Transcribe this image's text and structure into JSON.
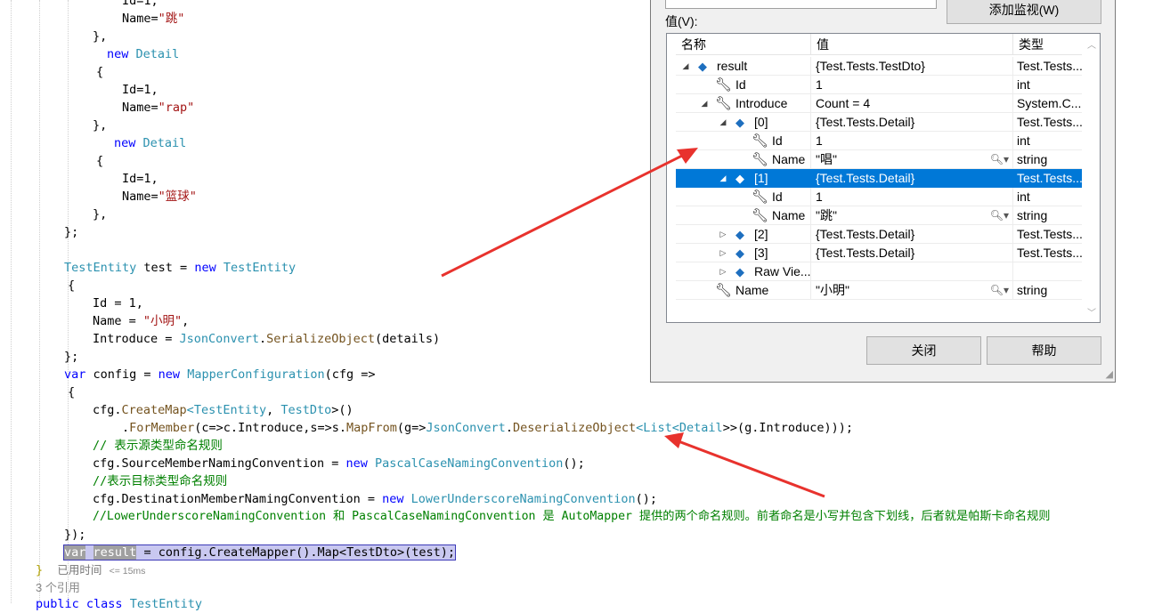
{
  "code": {
    "l1": "Id=1,",
    "l2_pre": "Name=",
    "l2_str": "\"跳\"",
    "l3": "},",
    "l4_kw": "new",
    "l4_ty": "Detail",
    "brace_open": "{",
    "l6": "Id=1,",
    "l7_pre": "Name=",
    "l7_str": "\"rap\"",
    "l8": "},",
    "l9_kw": "new",
    "l9_ty": "Detail",
    "l11": "Id=1,",
    "l12_pre": "Name=",
    "l12_str": "\"篮球\"",
    "l13": "},",
    "l14": "};",
    "l15_ty": "TestEntity",
    "l15_mid": " test = ",
    "l15_kw": "new",
    "l15_ty2": "TestEntity",
    "l17": "Id = 1,",
    "l18_pre": "Name = ",
    "l18_str": "\"小明\"",
    "l18_post": ",",
    "l19_pre": "Introduce = ",
    "l19_ty": "JsonConvert",
    "l19_dot": ".",
    "l19_mt": "SerializeObject",
    "l19_post": "(details)",
    "l20": "};",
    "l21_kw": "var",
    "l21_mid": " config = ",
    "l21_kw2": "new",
    "l21_ty": "MapperConfiguration",
    "l21_post": "(cfg =>",
    "l23_pre": "cfg.",
    "l23_mt": "CreateMap",
    "l23_lt": "<",
    "l23_ty1": "TestEntity",
    "l23_comma": ", ",
    "l23_ty2": "TestDto",
    "l23_post": ">()",
    "l24_pre": ".",
    "l24_mt": "ForMember",
    "l24_mid": "(c=>c.Introduce,s=>s.",
    "l24_mt2": "MapFrom",
    "l24_mid2": "(g=>",
    "l24_ty1": "JsonConvert",
    "l24_dot": ".",
    "l24_mt3": "DeserializeObject",
    "l24_lt": "<",
    "l24_ty2": "List",
    "l24_lt2": "<",
    "l24_ty3": "Detail",
    "l24_post": ">>(g.Introduce)));",
    "l25": "// 表示源类型命名规则",
    "l26_pre": "cfg.SourceMemberNamingConvention = ",
    "l26_kw": "new",
    "l26_ty": "PascalCaseNamingConvention",
    "l26_post": "();",
    "l27": "//表示目标类型命名规则",
    "l28_pre": "cfg.DestinationMemberNamingConvention = ",
    "l28_kw": "new",
    "l28_ty": "LowerUnderscoreNamingConvention",
    "l28_post": "();",
    "l29": "//LowerUnderscoreNamingConvention 和 PascalCaseNamingConvention 是 AutoMapper 提供的两个命名规则。前者命名是小写并包含下划线，后者就是帕斯卡命名规则",
    "l30": "});",
    "l31_kw": "var",
    "l31_var": "result",
    "l31_mid": " = config.",
    "l31_mt": "CreateMapper",
    "l31_mid2": "().",
    "l31_mt2": "Map",
    "l31_lt": "<",
    "l31_ty": "TestDto",
    "l31_post": ">(test);",
    "l32_brace": "}",
    "l32_hint": "已用时间",
    "l32_hint2": "<= 15ms",
    "l33_refs": "3 个引用",
    "l34_kw": "public",
    "l34_kw2": "class",
    "l34_ty": "TestEntity"
  },
  "quickwatch": {
    "add_watch": "添加监视(W)",
    "value_label": "值(V):",
    "columns": {
      "name": "名称",
      "value": "值",
      "type": "类型"
    },
    "rows": [
      {
        "name": "result",
        "value": "{Test.Tests.TestDto}",
        "type": "Test.Tests..."
      },
      {
        "name": "Id",
        "value": "1",
        "type": "int"
      },
      {
        "name": "Introduce",
        "value": "Count = 4",
        "type": "System.C..."
      },
      {
        "name": "[0]",
        "value": "{Test.Tests.Detail}",
        "type": "Test.Tests..."
      },
      {
        "name": "Id",
        "value": "1",
        "type": "int"
      },
      {
        "name": "Name",
        "value": "\"唱\"",
        "type": "string"
      },
      {
        "name": "[1]",
        "value": "{Test.Tests.Detail}",
        "type": "Test.Tests..."
      },
      {
        "name": "Id",
        "value": "1",
        "type": "int"
      },
      {
        "name": "Name",
        "value": "\"跳\"",
        "type": "string"
      },
      {
        "name": "[2]",
        "value": "{Test.Tests.Detail}",
        "type": "Test.Tests..."
      },
      {
        "name": "[3]",
        "value": "{Test.Tests.Detail}",
        "type": "Test.Tests..."
      },
      {
        "name": "Raw Vie...",
        "value": "",
        "type": ""
      },
      {
        "name": "Name",
        "value": "\"小明\"",
        "type": "string"
      }
    ],
    "close_button": "关闭",
    "help_button": "帮助"
  },
  "colors": {
    "keyword": "#0000ff",
    "type": "#2b91af",
    "string": "#a31515",
    "comment": "#008000",
    "selection": "#0078d7",
    "arrow": "#e8322d"
  },
  "icons": [
    "object-icon",
    "wrench-icon",
    "magnifier-icon",
    "expand-triangle-icon",
    "collapse-triangle-icon"
  ]
}
